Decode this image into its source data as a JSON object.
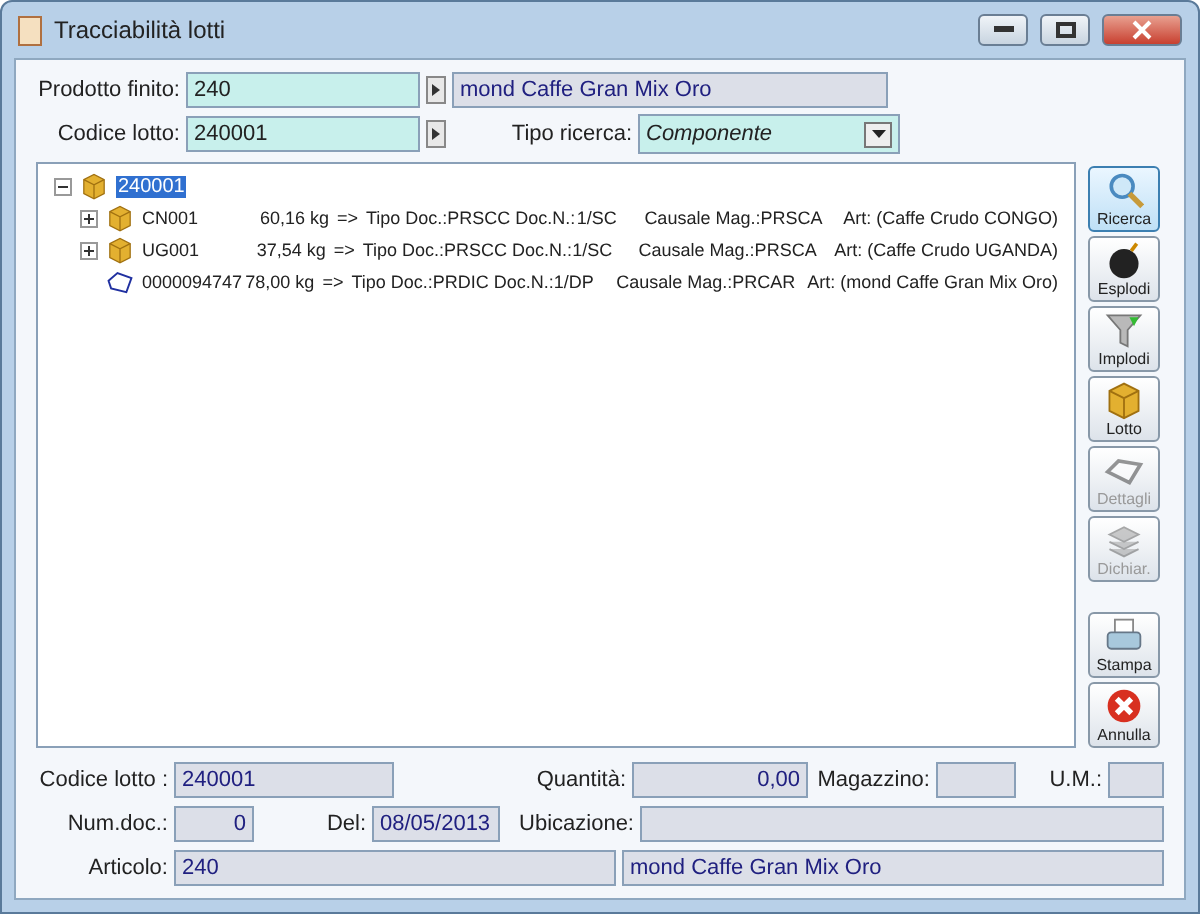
{
  "window": {
    "title": "Tracciabilità lotti"
  },
  "header": {
    "product_label": "Prodotto finito:",
    "product_code": "240",
    "product_name": "mond Caffe Gran Mix Oro",
    "lot_label": "Codice lotto:",
    "lot_code": "240001",
    "search_type_label": "Tipo ricerca:",
    "search_type": "Componente"
  },
  "tree": {
    "root": {
      "label": "240001",
      "selected": true,
      "expanded": true,
      "children": [
        {
          "kind": "lot",
          "code": "CN001",
          "expanded": false,
          "quantity": "60,16 kg",
          "arrow": "=>",
          "doc_type": "Tipo Doc.:PRSCC Doc.N.:",
          "doc_number": "1/SC",
          "causale": "Causale Mag.:PRSCA",
          "article": "Art: (Caffe Crudo CONGO)"
        },
        {
          "kind": "lot",
          "code": "UG001",
          "expanded": false,
          "quantity": "37,54 kg",
          "arrow": "=>",
          "doc_type": "Tipo Doc.:PRSCC Doc.N.:",
          "doc_number": "1/SC",
          "causale": "Causale Mag.:PRSCA",
          "article": "Art: (Caffe Crudo UGANDA)"
        },
        {
          "kind": "document",
          "code": "0000094747",
          "quantity": "78,00 kg",
          "arrow": "=>",
          "doc_type": "Tipo Doc.:PRDIC Doc.N.:",
          "doc_number": "1/DP",
          "causale": "Causale Mag.:PRCAR",
          "article": "Art: (mond Caffe Gran Mix Oro)"
        }
      ]
    }
  },
  "toolbar": [
    {
      "kind": "search",
      "label": "Ricerca",
      "selected": true,
      "disabled": false
    },
    {
      "kind": "bomb",
      "label": "Esplodi",
      "selected": false,
      "disabled": false
    },
    {
      "kind": "funnel",
      "label": "Implodi",
      "selected": false,
      "disabled": false
    },
    {
      "kind": "box",
      "label": "Lotto",
      "selected": false,
      "disabled": false
    },
    {
      "kind": "open",
      "label": "Dettagli",
      "selected": false,
      "disabled": true
    },
    {
      "kind": "stack",
      "label": "Dichiar.",
      "selected": false,
      "disabled": true
    },
    {
      "kind": "printer",
      "label": "Stampa",
      "selected": false,
      "disabled": false
    },
    {
      "kind": "cancel",
      "label": "Annulla",
      "selected": false,
      "disabled": false
    }
  ],
  "details": {
    "lot_label": "Codice lotto :",
    "lot": "240001",
    "quantity_label": "Quantità:",
    "quantity": "0,00",
    "warehouse_label": "Magazzino:",
    "unit_label": "U.M.:",
    "doc_label": "Num.doc.:",
    "doc": "0",
    "date_label": "Del:",
    "date": "08/05/2013",
    "location_label": "Ubicazione:",
    "article_label": "Articolo:",
    "article_code": "240",
    "article_name": "mond Caffe Gran Mix Oro"
  }
}
